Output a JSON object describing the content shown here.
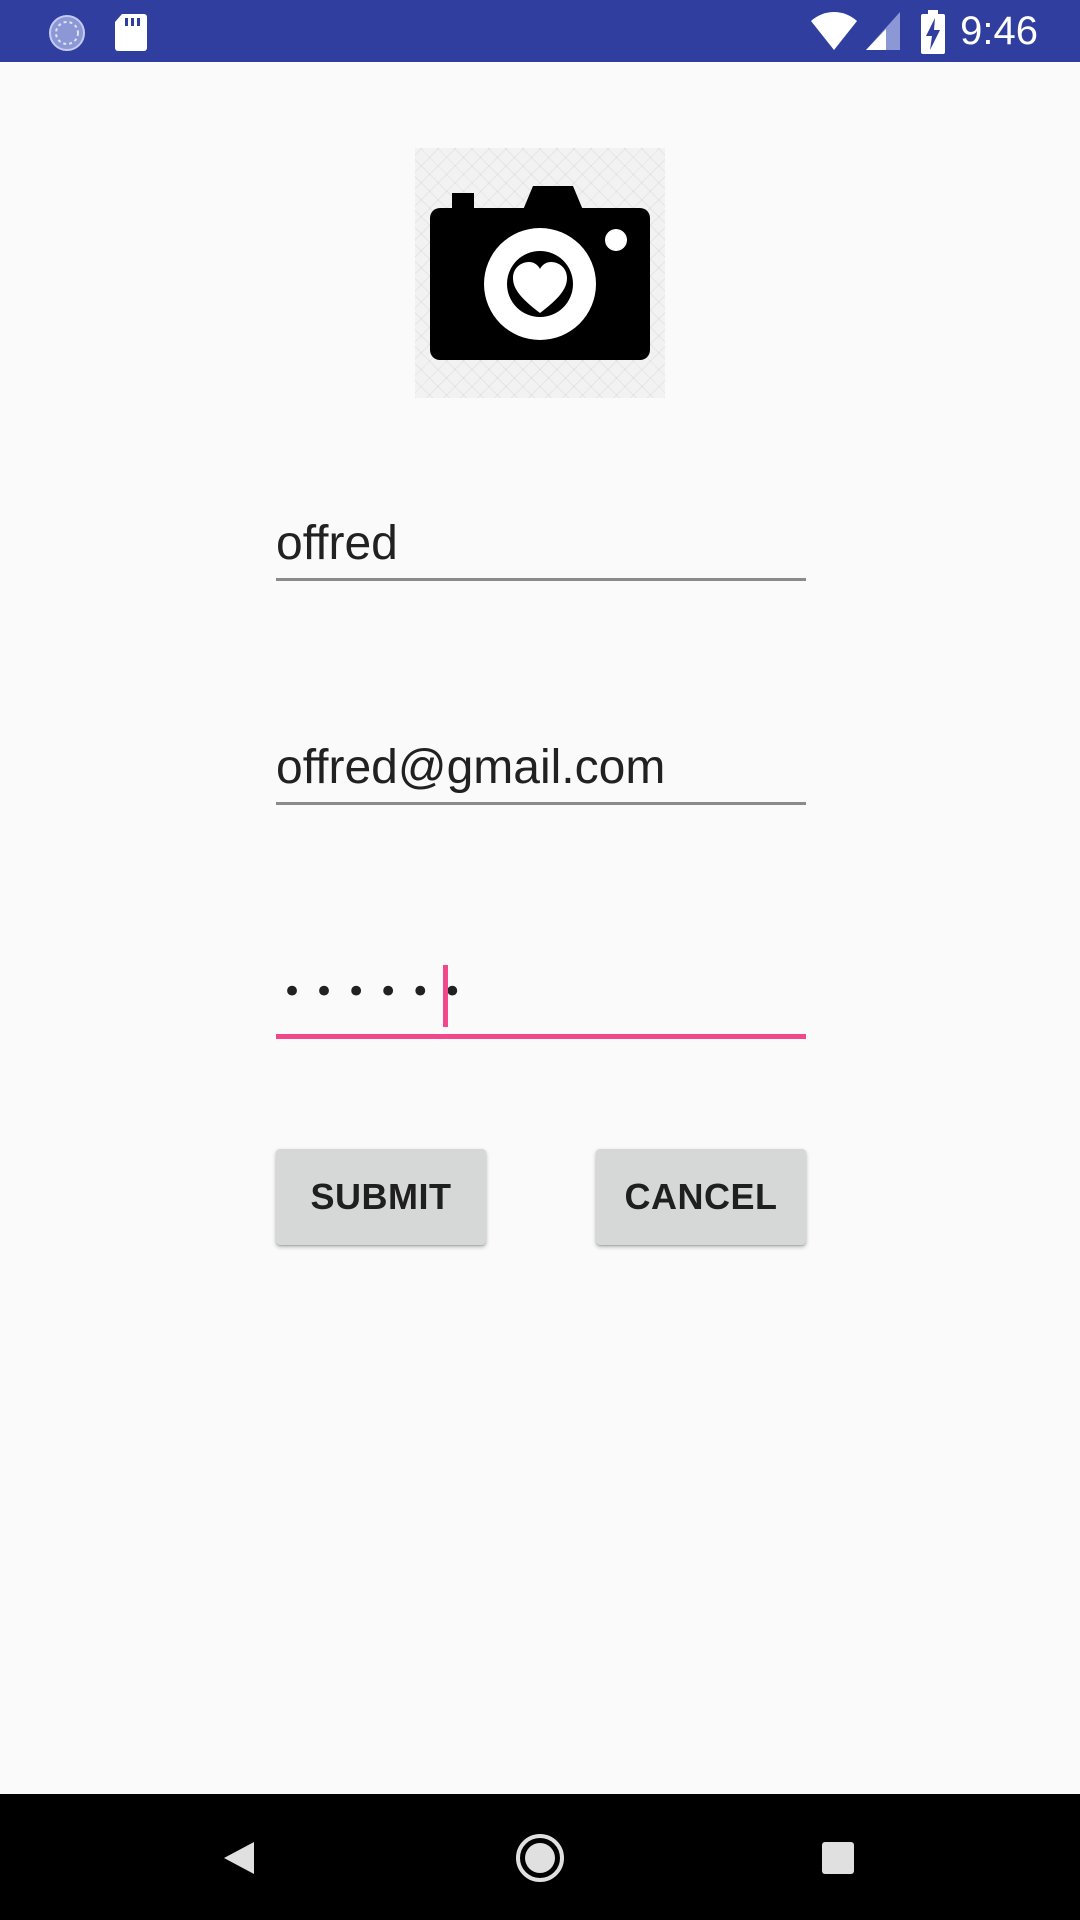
{
  "status_bar": {
    "time": "9:46",
    "left_icons": [
      "sync-icon",
      "sd-card-icon"
    ],
    "right_icons": [
      "wifi-icon",
      "cell-signal-icon",
      "battery-charging-icon"
    ]
  },
  "profile": {
    "image_icon": "camera-heart-icon"
  },
  "form": {
    "username_value": "offred",
    "email_value": "offred@gmail.com",
    "password_masked": "••••••",
    "focused_field": "password"
  },
  "buttons": {
    "submit_label": "SUBMIT",
    "cancel_label": "CANCEL"
  },
  "nav_bar": {
    "icons": [
      "back-icon",
      "home-icon",
      "recents-icon"
    ]
  },
  "colors": {
    "status_bar": "#303f9f",
    "accent": "#f0488b",
    "background": "#fafafa",
    "button": "#d6d7d7"
  }
}
